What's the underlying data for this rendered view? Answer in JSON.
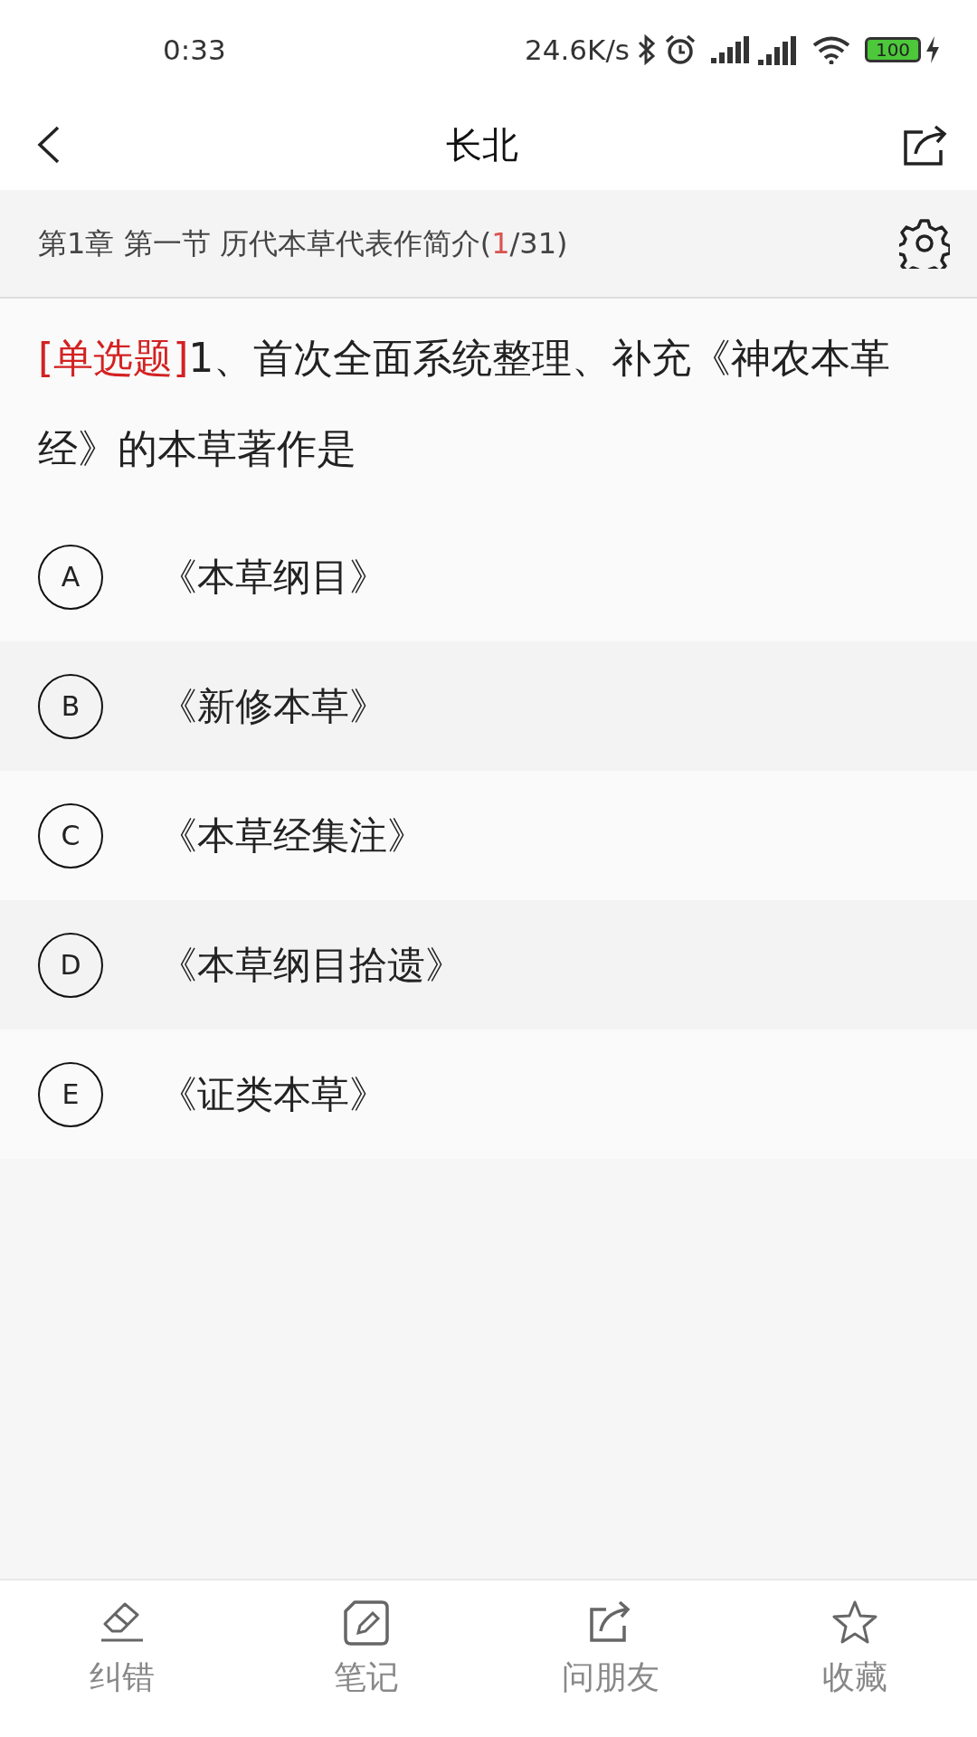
{
  "status_bar": {
    "time": "0:33",
    "net_speed": "24.6K/s",
    "battery": "100"
  },
  "header": {
    "title": "长北"
  },
  "chapter": {
    "prefix": "第1章 第一节 历代本草代表作简介(",
    "current": "1",
    "suffix": "/31)"
  },
  "question": {
    "type": "[单选题]",
    "text": "1、首次全面系统整理、补充《神农本革经》的本草著作是"
  },
  "options": [
    {
      "letter": "A",
      "text": "《本草纲目》"
    },
    {
      "letter": "B",
      "text": "《新修本草》"
    },
    {
      "letter": "C",
      "text": "《本草经集注》"
    },
    {
      "letter": "D",
      "text": "《本草纲目拾遗》"
    },
    {
      "letter": "E",
      "text": "《证类本草》"
    }
  ],
  "bottom_bar": [
    {
      "kind": "eraser",
      "label": "纠错"
    },
    {
      "kind": "note",
      "label": "笔记"
    },
    {
      "kind": "share",
      "label": "问朋友"
    },
    {
      "kind": "star",
      "label": "收藏"
    }
  ]
}
